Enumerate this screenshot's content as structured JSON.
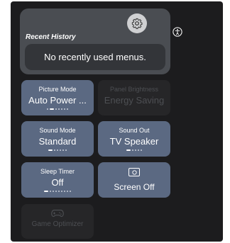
{
  "recent_history": {
    "title": "Recent History",
    "empty_message": "No recently used menus."
  },
  "header": {
    "settings_icon": "gear-icon",
    "accessibility_icon": "accessibility-icon"
  },
  "tiles": {
    "picture_mode": {
      "label": "Picture Mode",
      "value": "Auto Power ...",
      "option_count": 7,
      "selected_index": 1
    },
    "panel_brightness": {
      "label": "Panel Brightness",
      "value": "Energy Saving",
      "enabled": false
    },
    "sound_mode": {
      "label": "Sound Mode",
      "value": "Standard",
      "option_count": 6,
      "selected_index": 0
    },
    "sound_out": {
      "label": "Sound Out",
      "value": "TV Speaker",
      "option_count": 5,
      "selected_index": 0
    },
    "sleep_timer": {
      "label": "Sleep Timer",
      "value": "Off",
      "option_count": 9,
      "selected_index": 0
    },
    "screen_off": {
      "label": "Screen Off",
      "icon": "power-icon"
    },
    "game_optimizer": {
      "label": "Game Optimizer",
      "icon": "gamepad-icon",
      "enabled": false
    }
  },
  "colors": {
    "panel_bg": "#1c1c1e",
    "card_bg": "#4a4d52",
    "tile_active": "#5b6982",
    "tile_disabled": "#262628"
  }
}
